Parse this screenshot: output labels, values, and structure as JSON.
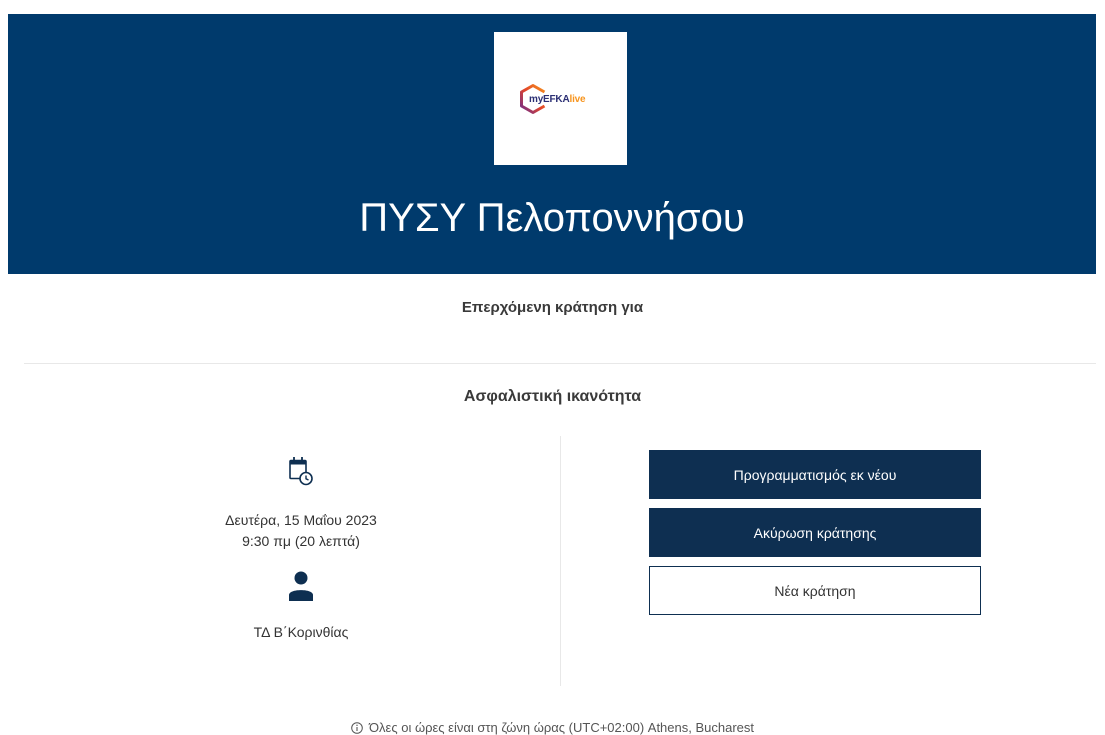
{
  "header": {
    "logo": {
      "brand": "myEFKA",
      "brand_suffix": "live"
    },
    "title": "ΠΥΣΥ Πελοποννήσου"
  },
  "booking": {
    "intro": "Επερχόμενη κράτηση για",
    "service": "Ασφαλιστική ικανότητα",
    "date": "Δευτέρα, 15 Μαΐου 2023",
    "time": "9:30 πμ (20 λεπτά)",
    "staff": "ΤΔ Β΄Κορινθίας"
  },
  "actions": {
    "reschedule": "Προγραμματισμός εκ νέου",
    "cancel": "Ακύρωση κράτησης",
    "new_booking": "Νέα κράτηση"
  },
  "footer": {
    "timezone_note": "Όλες οι ώρες είναι στη ζώνη ώρας (UTC+02:00) Athens, Bucharest"
  },
  "icons": {
    "logo_mark": "hexagon-logo-icon",
    "date": "calendar-clock-icon",
    "staff": "person-icon",
    "footer": "info-icon"
  },
  "colors": {
    "header_bg": "#003a6c",
    "button_bg": "#0e2f51",
    "logo_navy": "#2b2f74",
    "logo_orange": "#f7941d"
  }
}
